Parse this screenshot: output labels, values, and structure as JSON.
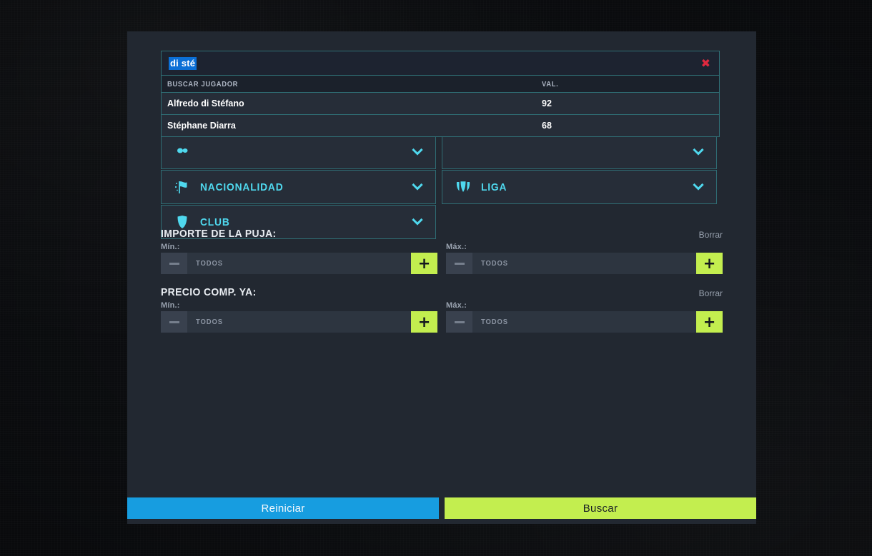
{
  "modal": {
    "search": {
      "value": "di sté",
      "placeholder": "Buscar jugador",
      "clear_icon": "close-x-icon",
      "clear_glyph": "✖",
      "results_header": {
        "name": "BUSCAR JUGADOR",
        "value": "VAL."
      },
      "results": [
        {
          "name": "Alfredo di Stéfano",
          "val": "92"
        },
        {
          "name": "Stéphane Diarra",
          "val": "68"
        }
      ]
    },
    "filters": [
      {
        "label": "NACIONALIDAD",
        "icon": "flag-icon",
        "chevron": "chevron-down-icon"
      },
      {
        "label": "LIGA",
        "icon": "league-trophy-icon",
        "chevron": "chevron-down-icon"
      },
      {
        "label": "CLUB",
        "icon": "shield-icon",
        "chevron": "chevron-down-icon"
      }
    ],
    "ranges": [
      {
        "title": "IMPORTE DE LA PUJA:",
        "clear_label": "Borrar",
        "min": {
          "label": "Mín.:",
          "value": "",
          "placeholder": "TODOS"
        },
        "max": {
          "label": "Máx.:",
          "value": "",
          "placeholder": "TODOS"
        },
        "minus_glyph": "—",
        "plus_glyph": "+"
      },
      {
        "title": "PRECIO COMP. YA:",
        "clear_label": "Borrar",
        "min": {
          "label": "Mín.:",
          "value": "",
          "placeholder": "TODOS"
        },
        "max": {
          "label": "Máx.:",
          "value": "",
          "placeholder": "TODOS"
        },
        "minus_glyph": "—",
        "plus_glyph": "+"
      }
    ],
    "footer": {
      "reset_label": "Reiniciar",
      "search_label": "Buscar"
    }
  },
  "colors": {
    "accent_cyan": "#4fd8ee",
    "accent_lime": "#c3ee4f",
    "accent_blue": "#179de0",
    "panel_bg": "#222831",
    "page_bg": "#15181d",
    "selection_blue": "#0b6fd6",
    "close_red": "#e0293f",
    "border_teal": "#2f6d74"
  }
}
